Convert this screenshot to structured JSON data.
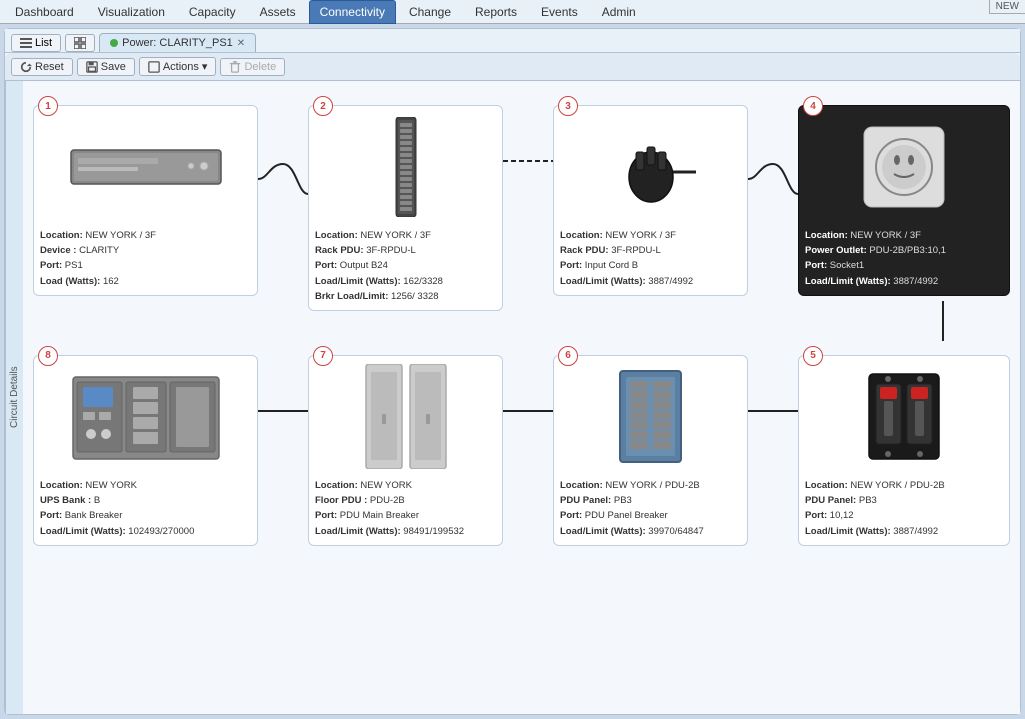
{
  "new_badge": "NEW",
  "nav": {
    "tabs": [
      {
        "label": "Dashboard",
        "active": false
      },
      {
        "label": "Visualization",
        "active": false
      },
      {
        "label": "Capacity",
        "active": false
      },
      {
        "label": "Assets",
        "active": false
      },
      {
        "label": "Connectivity",
        "active": true
      },
      {
        "label": "Change",
        "active": false
      },
      {
        "label": "Reports",
        "active": false
      },
      {
        "label": "Events",
        "active": false
      },
      {
        "label": "Admin",
        "active": false
      }
    ]
  },
  "toolbar": {
    "list_label": "List",
    "reset_label": "Reset",
    "save_label": "Save",
    "actions_label": "Actions",
    "delete_label": "Delete",
    "tab_label": "Power: CLARITY_PS1"
  },
  "side_label": "Circuit Details",
  "nodes": [
    {
      "number": "1",
      "type": "server",
      "location": "NEW YORK / 3F",
      "device": "CLARITY",
      "port": "PS1",
      "load_watts": "162"
    },
    {
      "number": "2",
      "type": "rack_pdu",
      "location": "NEW YORK / 3F",
      "rack_pdu": "3F-RPDU-L",
      "port": "Output B24",
      "load_limit": "162/3328",
      "brkr_load_limit": "1256/ 3328"
    },
    {
      "number": "3",
      "type": "plug",
      "location": "NEW YORK / 3F",
      "rack_pdu": "3F-RPDU-L",
      "port": "Input Cord B",
      "load_limit": "3887/4992"
    },
    {
      "number": "4",
      "type": "outlet",
      "location": "NEW YORK / 3F",
      "power_outlet": "PDU-2B/PB3:10,1",
      "port": "Socket1",
      "load_limit": "3887/4992"
    },
    {
      "number": "5",
      "type": "breaker",
      "location": "NEW YORK / PDU-2B",
      "pdu_panel": "PB3",
      "port": "10,12",
      "load_limit": "3887/4992"
    },
    {
      "number": "6",
      "type": "panel",
      "location": "NEW YORK / PDU-2B",
      "pdu_panel": "PB3",
      "port": "PDU Panel Breaker",
      "load_limit": "39970/64847"
    },
    {
      "number": "7",
      "type": "floor_pdu",
      "location": "NEW YORK",
      "floor_pdu": "PDU-2B",
      "port": "PDU Main Breaker",
      "load_limit": "98491/199532"
    },
    {
      "number": "8",
      "type": "ups",
      "location": "NEW YORK",
      "ups_bank": "B",
      "port": "Bank Breaker",
      "load_limit": "102493/270000"
    }
  ]
}
